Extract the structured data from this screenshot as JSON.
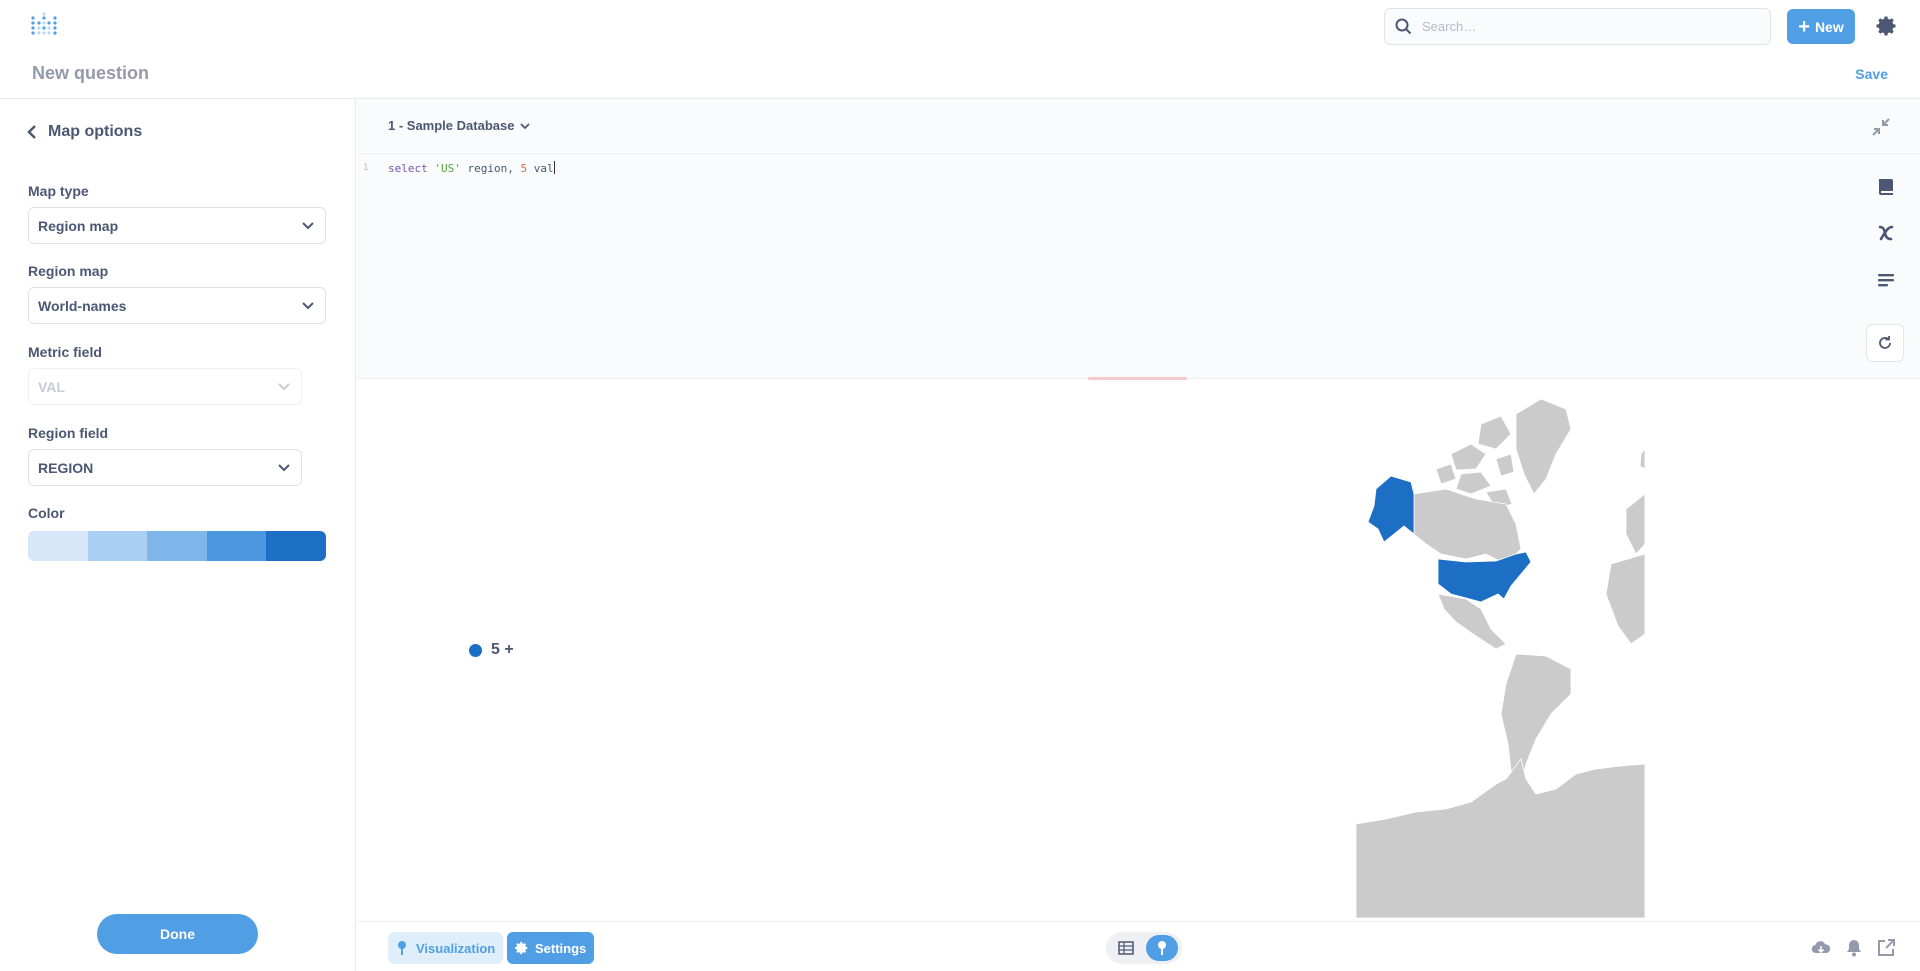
{
  "app": {
    "logo_icon": "metabase-logo-icon",
    "search": {
      "placeholder": "Search…",
      "icon": "search-icon"
    },
    "new_button": {
      "label": "New",
      "icon": "plus-icon"
    },
    "settings_icon": "gear-icon"
  },
  "question": {
    "title": "New question",
    "save_label": "Save"
  },
  "sidebar": {
    "title": "Map options",
    "back_icon": "chevron-left-icon",
    "fields": {
      "map_type": {
        "label": "Map type",
        "value": "Region map"
      },
      "region_map": {
        "label": "Region map",
        "value": "World-names"
      },
      "metric_field": {
        "label": "Metric field",
        "value": "VAL",
        "disabled": true
      },
      "region_field": {
        "label": "Region field",
        "value": "REGION"
      }
    },
    "color": {
      "label": "Color",
      "swatches": [
        "#d5e7f9",
        "#a9cff2",
        "#7fb6ea",
        "#4a97e0",
        "#1c6fc4"
      ]
    },
    "done_label": "Done"
  },
  "editor": {
    "database": "1 - Sample Database",
    "line_number": "1",
    "code": {
      "kw": "select",
      "str": "'US'",
      "ident1": "region,",
      "num": "5",
      "ident2": "val"
    },
    "rail_icons": [
      "reference-book-icon",
      "variable-x-icon",
      "snippet-icon",
      "refresh-icon"
    ],
    "collapse_icon": "collapse-icon"
  },
  "visualization": {
    "legend_label": "5 +",
    "legend_color": "#1c6fc4",
    "highlighted_region": "US",
    "highlight_color": "#1c6fc4",
    "base_color": "#cbcbcb"
  },
  "footer": {
    "visualization_label": "Visualization",
    "settings_label": "Settings",
    "toggle": [
      "table-icon",
      "pin-map-icon"
    ],
    "actions": [
      "download-icon",
      "bell-icon",
      "external-link-icon"
    ]
  }
}
